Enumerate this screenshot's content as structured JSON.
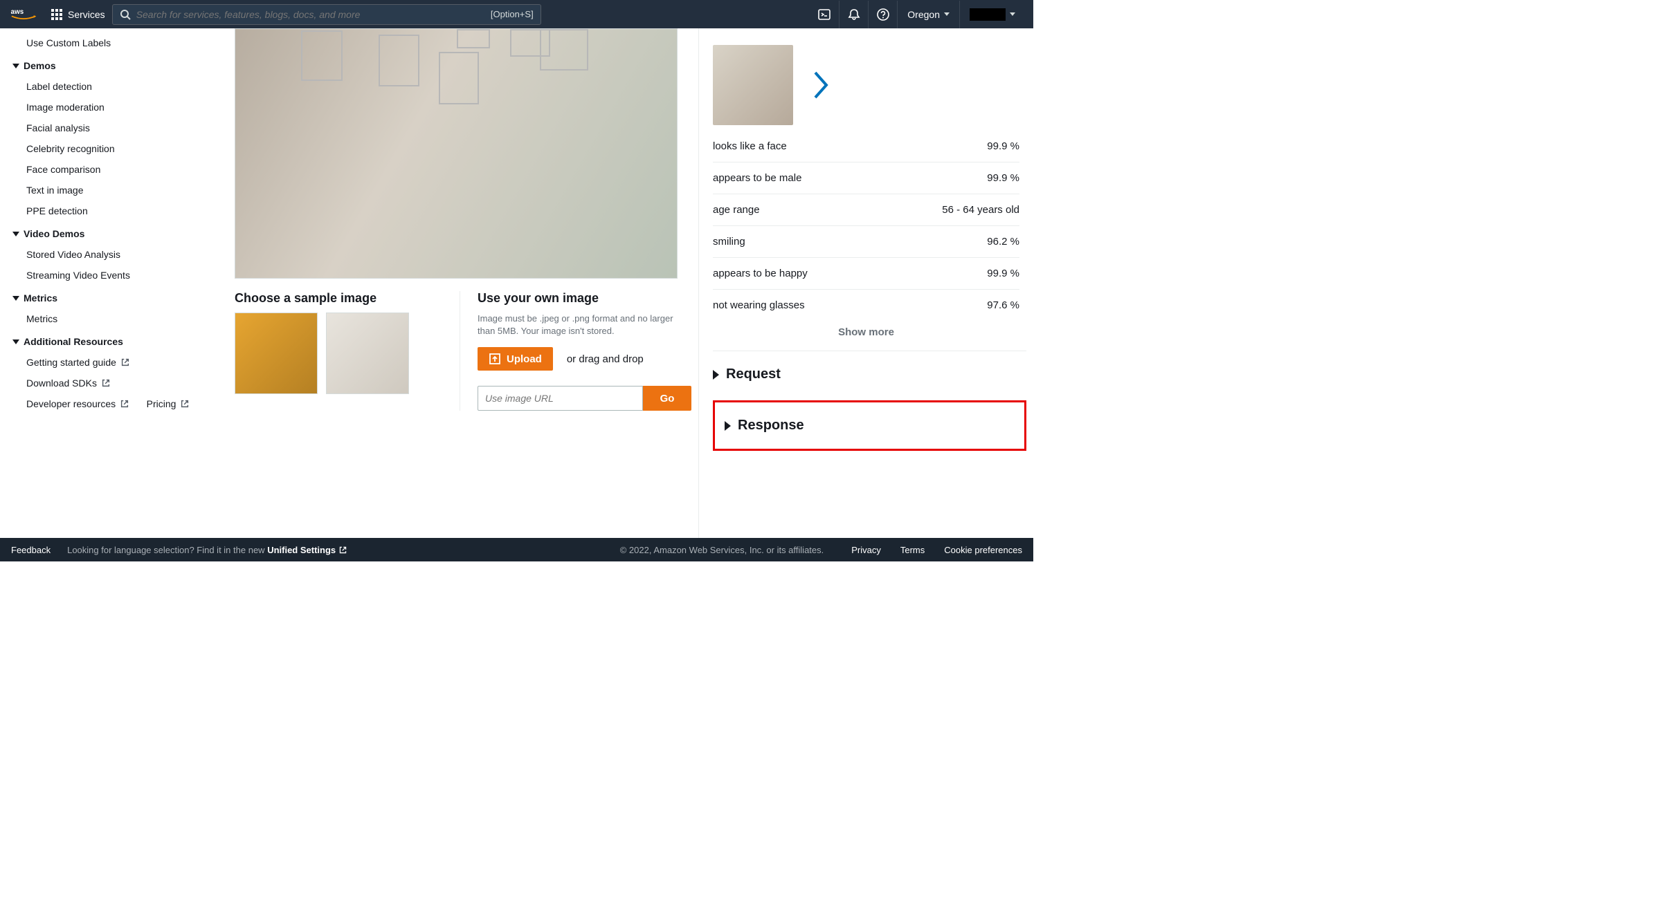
{
  "topnav": {
    "services_label": "Services",
    "search_placeholder": "Search for services, features, blogs, docs, and more",
    "search_shortcut": "[Option+S]",
    "region": "Oregon"
  },
  "sidebar": {
    "item_custom_labels": "Use Custom Labels",
    "group_demos": "Demos",
    "demos": {
      "label_detection": "Label detection",
      "image_moderation": "Image moderation",
      "facial_analysis": "Facial analysis",
      "celebrity_recognition": "Celebrity recognition",
      "face_comparison": "Face comparison",
      "text_in_image": "Text in image",
      "ppe_detection": "PPE detection"
    },
    "group_video_demos": "Video Demos",
    "video_demos": {
      "stored": "Stored Video Analysis",
      "streaming": "Streaming Video Events"
    },
    "group_metrics": "Metrics",
    "metrics_item": "Metrics",
    "group_additional": "Additional Resources",
    "additional": {
      "getting_started": "Getting started guide",
      "download_sdks": "Download SDKs",
      "developer_resources": "Developer resources",
      "pricing": "Pricing"
    }
  },
  "content": {
    "choose_sample": "Choose a sample image",
    "use_own": "Use your own image",
    "own_hint": "Image must be .jpeg or .png format and no larger than 5MB. Your image isn't stored.",
    "upload_label": "Upload",
    "drag_text": "or drag and drop",
    "url_placeholder": "Use image URL",
    "go_label": "Go"
  },
  "results": {
    "attrs": [
      {
        "label": "looks like a face",
        "value": "99.9 %"
      },
      {
        "label": "appears to be male",
        "value": "99.9 %"
      },
      {
        "label": "age range",
        "value": "56 - 64 years old"
      },
      {
        "label": "smiling",
        "value": "96.2 %"
      },
      {
        "label": "appears to be happy",
        "value": "99.9 %"
      },
      {
        "label": "not wearing glasses",
        "value": "97.6 %"
      }
    ],
    "show_more": "Show more",
    "request": "Request",
    "response": "Response"
  },
  "footer": {
    "feedback": "Feedback",
    "lang_prompt_a": "Looking for language selection? Find it in the new ",
    "unified": "Unified Settings",
    "copyright": "© 2022, Amazon Web Services, Inc. or its affiliates.",
    "privacy": "Privacy",
    "terms": "Terms",
    "cookie": "Cookie preferences"
  }
}
